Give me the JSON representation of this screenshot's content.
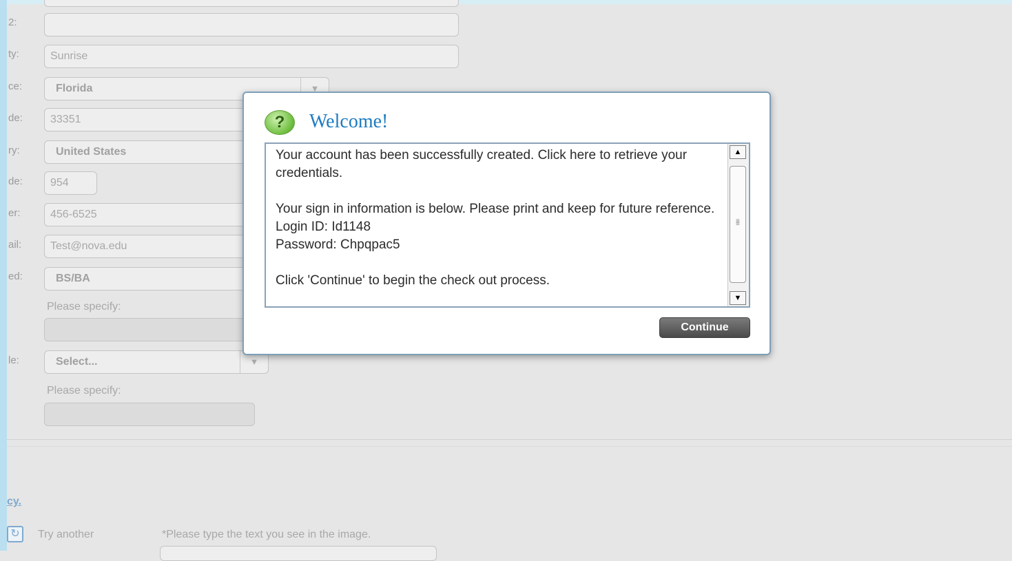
{
  "form": {
    "rows": [
      {
        "label": "2:",
        "value": "",
        "kind": "text"
      },
      {
        "label": "ty:",
        "value": "Sunrise",
        "kind": "text"
      },
      {
        "label": "ce:",
        "value": "Florida",
        "kind": "select"
      },
      {
        "label": "de:",
        "value": "33351",
        "kind": "text"
      },
      {
        "label": "ry:",
        "value": "United States",
        "kind": "select"
      },
      {
        "label": "de:",
        "value": "954",
        "kind": "text"
      },
      {
        "label": "er:",
        "value": "456-6525",
        "kind": "text"
      },
      {
        "label": "ail:",
        "value": "Test@nova.edu",
        "kind": "text"
      },
      {
        "label": "ed:",
        "value": "BS/BA",
        "kind": "select"
      },
      {
        "label": "le:",
        "value": "Select...",
        "kind": "select"
      }
    ],
    "please_specify_1": "Please specify:",
    "please_specify_2": "Please specify:",
    "privacy_link": "cy.",
    "try_another": "Try another",
    "captcha_hint": "*Please type the text you see in the image."
  },
  "modal": {
    "title": "Welcome!",
    "icon": "question-icon",
    "line1": "Your account has been successfully created. Click here to retrieve your credentials.",
    "line2": "Your sign in information is below. Please print and keep for future reference.",
    "login_id": "Login ID: Id1148",
    "password": "Password: Chpqpac5",
    "line3": "Click 'Continue' to begin the check out process.",
    "continue_label": "Continue"
  }
}
